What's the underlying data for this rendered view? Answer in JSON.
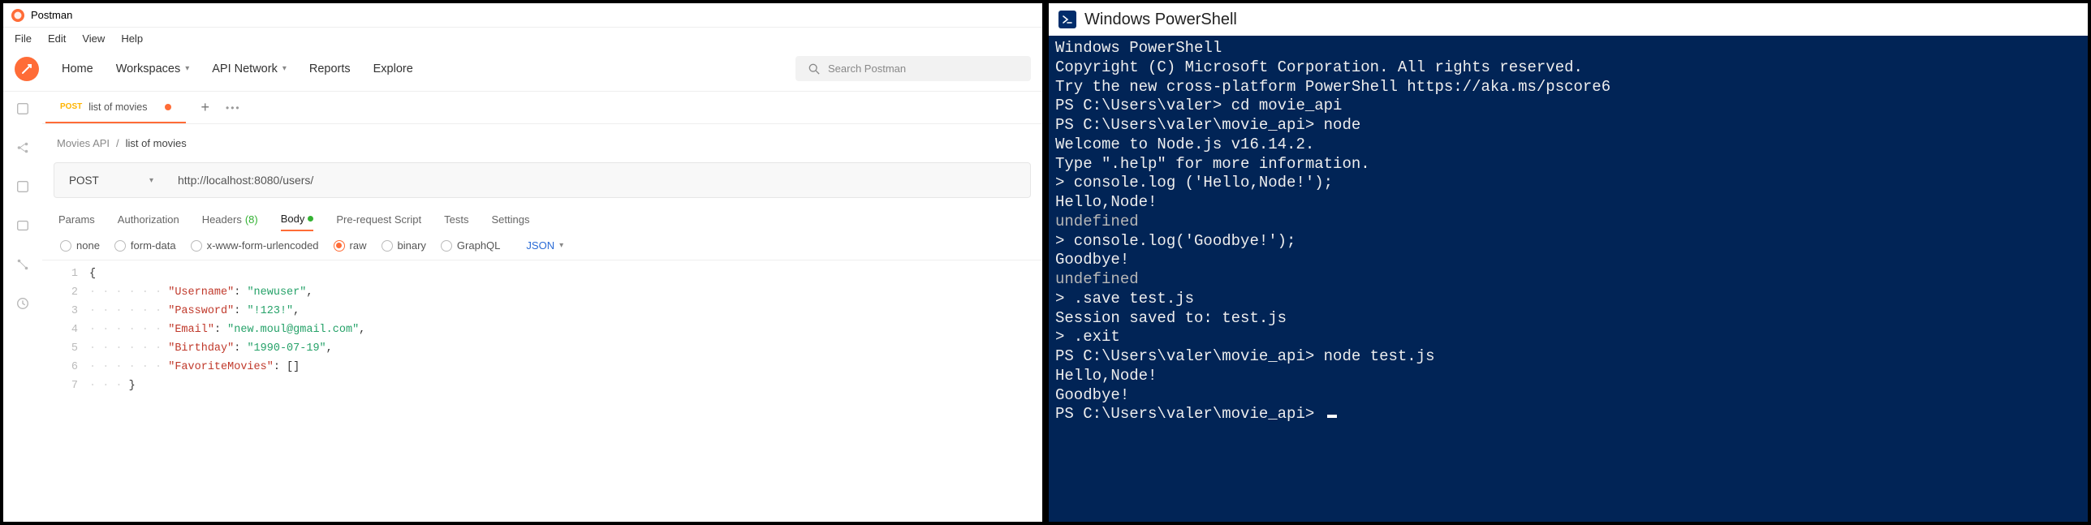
{
  "postman": {
    "window_title": "Postman",
    "menu": [
      "File",
      "Edit",
      "View",
      "Help"
    ],
    "nav": {
      "home": "Home",
      "workspaces": "Workspaces",
      "api_network": "API Network",
      "reports": "Reports",
      "explore": "Explore"
    },
    "search_placeholder": "Search Postman",
    "tab": {
      "method": "POST",
      "name": "list of movies"
    },
    "breadcrumb": {
      "root": "Movies API",
      "sep": "/",
      "current": "list of movies"
    },
    "request": {
      "method": "POST",
      "url": "http://localhost:8080/users/"
    },
    "req_tabs": {
      "params": "Params",
      "authorization": "Authorization",
      "headers_label": "Headers",
      "headers_count": "(8)",
      "body": "Body",
      "prerequest": "Pre-request Script",
      "tests": "Tests",
      "settings": "Settings"
    },
    "body_types": {
      "none": "none",
      "formdata": "form-data",
      "xform": "x-www-form-urlencoded",
      "raw": "raw",
      "binary": "binary",
      "graphql": "GraphQL",
      "format": "JSON"
    },
    "editor_lines": {
      "l1": "{",
      "l2_key": "\"Username\"",
      "l2_val": "\"newuser\"",
      "l3_key": "\"Password\"",
      "l3_val": "\"!123!\"",
      "l4_key": "\"Email\"",
      "l4_val": "\"new.moul@gmail.com\"",
      "l5_key": "\"Birthday\"",
      "l5_val": "\"1990-07-19\"",
      "l6_key": "\"FavoriteMovies\"",
      "l6_val": "[]",
      "l7": "}"
    },
    "editor_gutters": [
      "1",
      "2",
      "3",
      "4",
      "5",
      "6",
      "7"
    ]
  },
  "powershell": {
    "window_title": "Windows PowerShell",
    "lines": [
      {
        "t": "Windows PowerShell",
        "c": "w"
      },
      {
        "t": "Copyright (C) Microsoft Corporation. All rights reserved.",
        "c": "w"
      },
      {
        "t": "",
        "c": "w"
      },
      {
        "t": "Try the new cross-platform PowerShell https://aka.ms/pscore6",
        "c": "w"
      },
      {
        "t": "",
        "c": "w"
      },
      {
        "t": "PS C:\\Users\\valer> cd movie_api",
        "c": "w"
      },
      {
        "t": "PS C:\\Users\\valer\\movie_api> node",
        "c": "w"
      },
      {
        "t": "Welcome to Node.js v16.14.2.",
        "c": "w"
      },
      {
        "t": "Type \".help\" for more information.",
        "c": "w"
      },
      {
        "t": "> console.log ('Hello,Node!');",
        "c": "w"
      },
      {
        "t": "Hello,Node!",
        "c": "w"
      },
      {
        "t": "undefined",
        "c": "g"
      },
      {
        "t": "> console.log('Goodbye!');",
        "c": "w"
      },
      {
        "t": "Goodbye!",
        "c": "w"
      },
      {
        "t": "undefined",
        "c": "g"
      },
      {
        "t": "> .save test.js",
        "c": "w"
      },
      {
        "t": "Session saved to: test.js",
        "c": "w"
      },
      {
        "t": "> .exit",
        "c": "w"
      },
      {
        "t": "PS C:\\Users\\valer\\movie_api> node test.js",
        "c": "w"
      },
      {
        "t": "Hello,Node!",
        "c": "w"
      },
      {
        "t": "Goodbye!",
        "c": "w"
      },
      {
        "t": "PS C:\\Users\\valer\\movie_api> ",
        "c": "w",
        "cursor": true
      }
    ]
  }
}
